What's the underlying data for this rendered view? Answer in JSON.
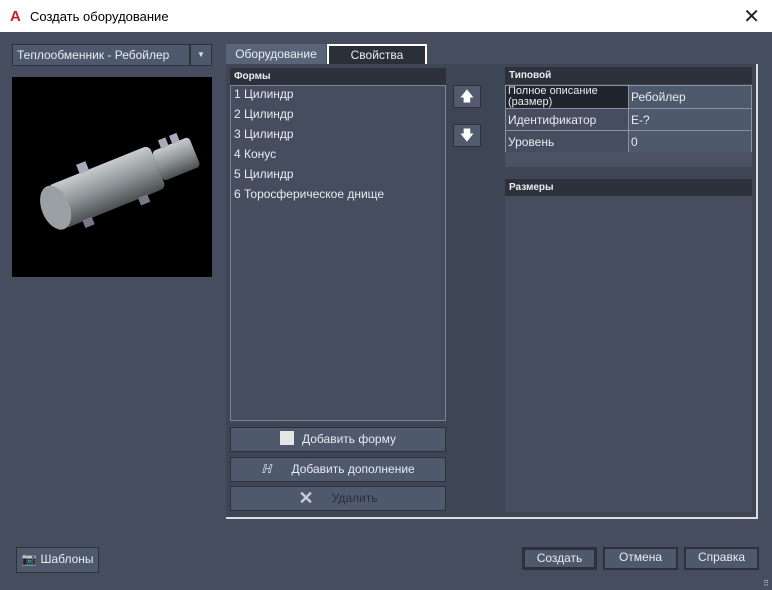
{
  "window": {
    "title": "Создать оборудование",
    "logo": "A",
    "close_icon": "close-icon"
  },
  "equipment_type": {
    "selected": "Теплообменник - Ребойлер"
  },
  "tabs": [
    {
      "label": "Оборудование",
      "active": false
    },
    {
      "label": "Свойства",
      "active": true
    }
  ],
  "shapes": {
    "header": "Формы",
    "items": [
      "1 Цилиндр",
      "2 Цилиндр",
      "3 Цилиндр",
      "4 Конус",
      "5 Цилиндр",
      "6 Торосферическое днище"
    ]
  },
  "move_up_icon": "arrow-up-icon",
  "move_down_icon": "arrow-down-icon",
  "properties": {
    "header": "Типовой",
    "rows": [
      {
        "key": "Полное описание (размер)",
        "value": "Ребойлер"
      },
      {
        "key": "Идентификатор",
        "value": "E-?"
      },
      {
        "key": "Уровень",
        "value": "0"
      }
    ]
  },
  "dimensions": {
    "header": "Размеры"
  },
  "actions": {
    "add_shape": "Добавить форму",
    "add_fitting": "Добавить дополнение",
    "delete": "Удалить"
  },
  "footer": {
    "templates": "Шаблоны",
    "create": "Создать",
    "cancel": "Отмена",
    "help": "Справка"
  }
}
